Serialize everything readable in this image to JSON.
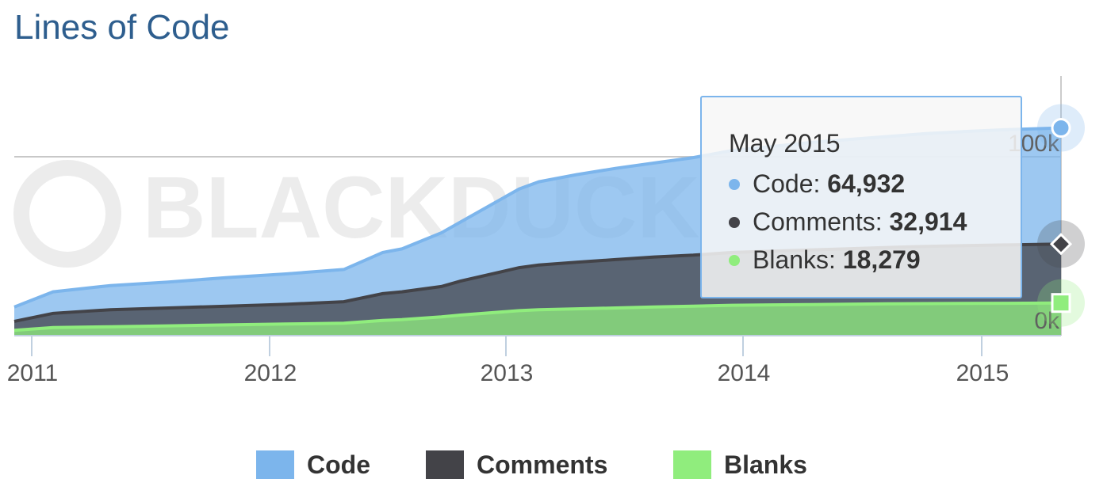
{
  "title": "Lines of Code",
  "watermark": "BLACKDUCK",
  "colors": {
    "code": "#7cb5ec",
    "comments": "#434348",
    "blanks": "#90ed7d",
    "title": "#2e5e8e"
  },
  "tooltip": {
    "title": "May 2015",
    "rows": [
      {
        "label": "Code",
        "value": "64,932",
        "color": "#7cb5ec"
      },
      {
        "label": "Comments",
        "value": "32,914",
        "color": "#434348"
      },
      {
        "label": "Blanks",
        "value": "18,279",
        "color": "#90ed7d"
      }
    ]
  },
  "chart_data": {
    "type": "area",
    "stacked": true,
    "x_tick_labels": [
      "2011",
      "2012",
      "2013",
      "2014",
      "2015"
    ],
    "y_tick_labels": [
      "0k",
      "100k"
    ],
    "ylim": [
      0,
      140000
    ],
    "x": [
      "2010-11",
      "2011-01",
      "2011-04",
      "2011-07",
      "2011-10",
      "2012-01",
      "2012-04",
      "2012-06",
      "2012-07",
      "2012-09",
      "2012-10",
      "2013-01",
      "2013-02",
      "2013-04",
      "2013-06",
      "2013-08",
      "2013-10",
      "2013-12",
      "2014-02",
      "2014-04",
      "2014-06",
      "2014-08",
      "2014-10",
      "2014-12",
      "2015-02",
      "2015-05"
    ],
    "series": [
      {
        "name": "Blanks",
        "values": [
          3000,
          4500,
          5000,
          5500,
          6000,
          6500,
          7000,
          8500,
          9000,
          10500,
          11500,
          14000,
          14500,
          15000,
          15500,
          16000,
          16500,
          17000,
          17200,
          17400,
          17600,
          17800,
          17900,
          18000,
          18100,
          18279
        ]
      },
      {
        "name": "Comments",
        "values": [
          5000,
          8000,
          9500,
          10000,
          10500,
          11000,
          12000,
          15000,
          15500,
          17000,
          19000,
          24000,
          25000,
          26000,
          27000,
          28000,
          28500,
          29500,
          30000,
          30500,
          31000,
          31500,
          32000,
          32300,
          32600,
          32914
        ]
      },
      {
        "name": "Code",
        "values": [
          8000,
          12000,
          13500,
          14500,
          16000,
          17000,
          18000,
          23000,
          24000,
          30000,
          33000,
          44000,
          46500,
          49000,
          51000,
          52500,
          54500,
          57000,
          58500,
          60000,
          61000,
          62000,
          63000,
          63800,
          64400,
          64932
        ]
      }
    ],
    "grid": true,
    "legend": "bottom-center"
  },
  "legend": [
    {
      "label": "Code",
      "color": "#7cb5ec"
    },
    {
      "label": "Comments",
      "color": "#434348"
    },
    {
      "label": "Blanks",
      "color": "#90ed7d"
    }
  ]
}
